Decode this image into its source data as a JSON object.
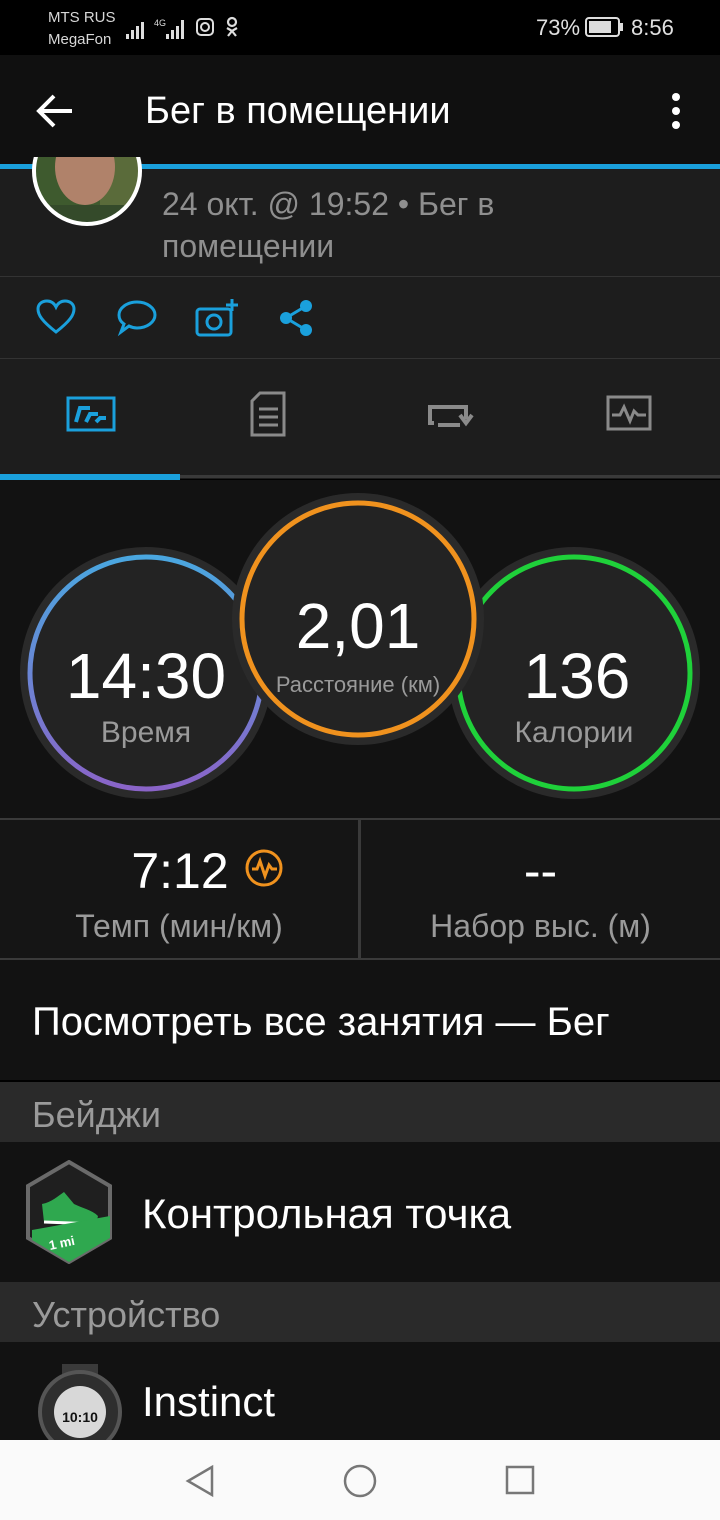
{
  "status": {
    "carrier1": "MTS RUS",
    "carrier2": "MegaFon",
    "network": "4G",
    "battery": "73%",
    "time": "8:56"
  },
  "toolbar": {
    "title": "Бег в помещении"
  },
  "activity": {
    "date_time": "24 окт. @ 19:52 • Бег в",
    "type_line2": "помещении"
  },
  "stats": {
    "time": {
      "value": "14:30",
      "label": "Время"
    },
    "distance": {
      "value": "2,01",
      "label": "Расстояние (км)"
    },
    "calories": {
      "value": "136",
      "label": "Калории"
    }
  },
  "metrics": {
    "pace": {
      "value": "7:12",
      "label": "Темп (мин/км)"
    },
    "elevation": {
      "value": "--",
      "label": "Набор выс. (м)"
    }
  },
  "links": {
    "all_activities": "Посмотреть все занятия — Бег"
  },
  "badges": {
    "header": "Бейджи",
    "item": "Контрольная точка",
    "badge_text": "1 mi"
  },
  "device": {
    "header": "Устройство",
    "name": "Instinct",
    "watch_time": "10:10"
  },
  "colors": {
    "accent": "#1aa0dc",
    "time_ring": "#6c7fd6",
    "distance_ring": "#f0921e",
    "calories_ring": "#1fd13a"
  }
}
